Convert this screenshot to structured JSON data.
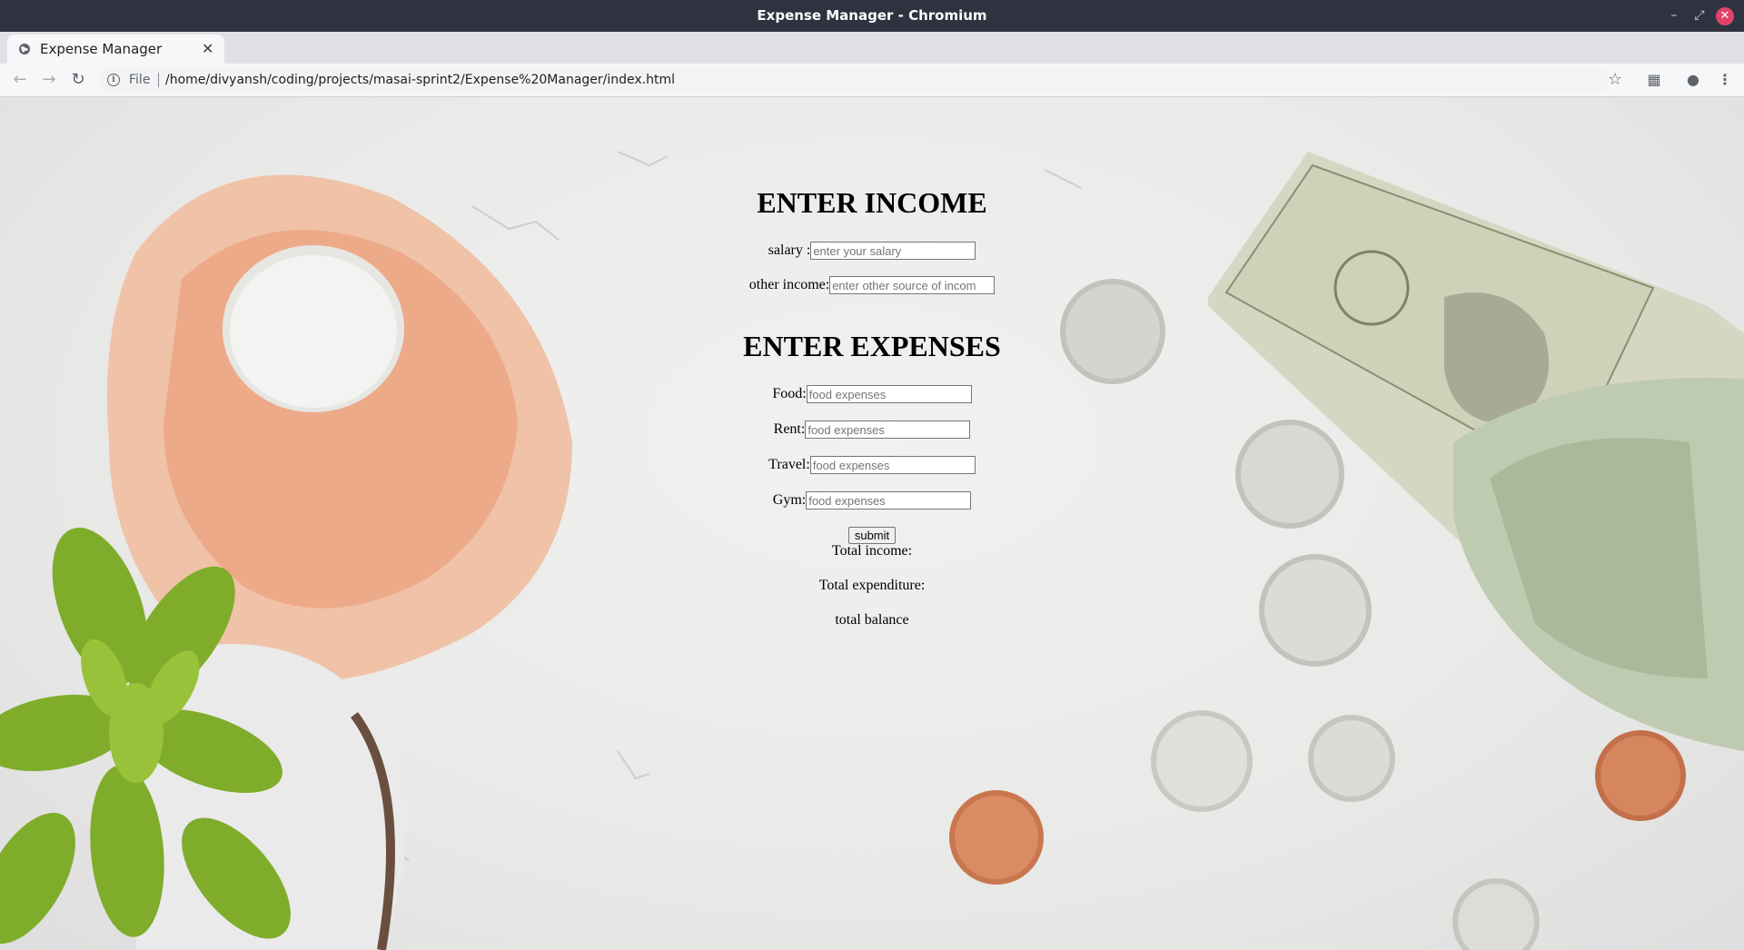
{
  "window": {
    "title": "Expense Manager - Chromium"
  },
  "tab": {
    "title": "Expense Manager"
  },
  "omnibox": {
    "scheme": "File",
    "url": "/home/divyansh/coding/projects/masai-sprint2/Expense%20Manager/index.html"
  },
  "income": {
    "heading": "ENTER INCOME",
    "salary_label": "salary :",
    "salary_placeholder": "enter your salary",
    "other_label": "other income:",
    "other_placeholder": "enter other source of incom"
  },
  "expenses": {
    "heading": "ENTER EXPENSES",
    "food_label": "Food:",
    "food_placeholder": "food expenses",
    "rent_label": "Rent:",
    "rent_placeholder": "food expenses",
    "travel_label": "Travel:",
    "travel_placeholder": "food expenses",
    "gym_label": "Gym:",
    "gym_placeholder": "food expenses"
  },
  "submit_label": "submit",
  "results": {
    "total_income": "Total income:",
    "total_expenditure": "Total expenditure:",
    "total_balance": "total balance"
  },
  "icons": {
    "window_min": "minimize-icon",
    "window_max": "maximize-icon",
    "window_close": "close-icon",
    "back": "arrow-left-icon",
    "forward": "arrow-right-icon",
    "reload": "reload-icon",
    "info": "info-icon",
    "bookmark": "star-icon",
    "extension": "extension-icon",
    "profile": "profile-icon",
    "menu": "kebab-menu-icon"
  }
}
